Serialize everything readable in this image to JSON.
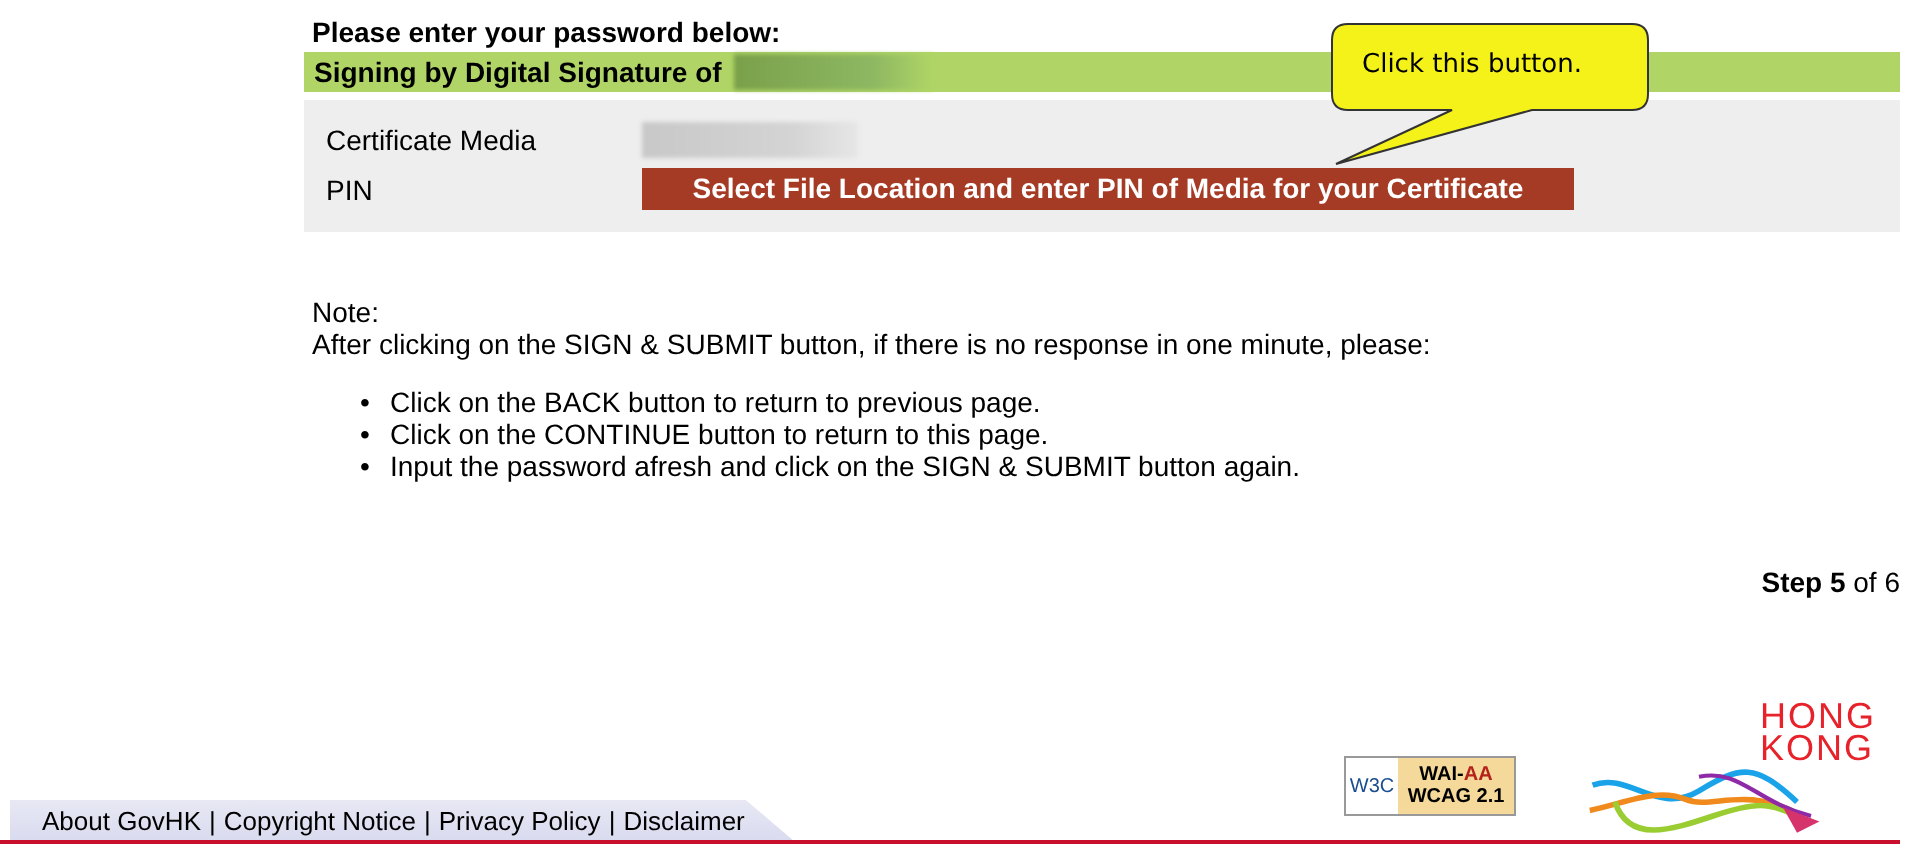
{
  "heading": "Please enter your password below:",
  "signing_bar": {
    "label": "Signing by Digital Signature of"
  },
  "form": {
    "rows": [
      {
        "kind": "redacted",
        "label": "Certificate Media"
      },
      {
        "kind": "button",
        "label": "PIN",
        "button": "Select File Location and enter PIN of Media for your Certificate"
      }
    ]
  },
  "callout": {
    "text": "Click this button."
  },
  "note": {
    "title": "Note:",
    "intro": "After clicking on the SIGN & SUBMIT button, if there is no response in one minute, please:",
    "bullet": "•",
    "items": [
      "Click on the BACK button to return to previous page.",
      "Click on the CONTINUE button to return to this page.",
      "Input the password afresh and click on the SIGN & SUBMIT button again."
    ]
  },
  "step": {
    "label": "Step",
    "current": "5",
    "rest": "of 6"
  },
  "badge": {
    "w3c": "W3C",
    "prefix": "WAI-",
    "level": "AA",
    "standard": "WCAG 2.1"
  },
  "logo": {
    "line1": "HONG",
    "line2": "KONG"
  },
  "footer": {
    "separator": "|",
    "links": [
      "About GovHK",
      "Copyright Notice",
      "Privacy Policy",
      "Disclaimer"
    ]
  }
}
